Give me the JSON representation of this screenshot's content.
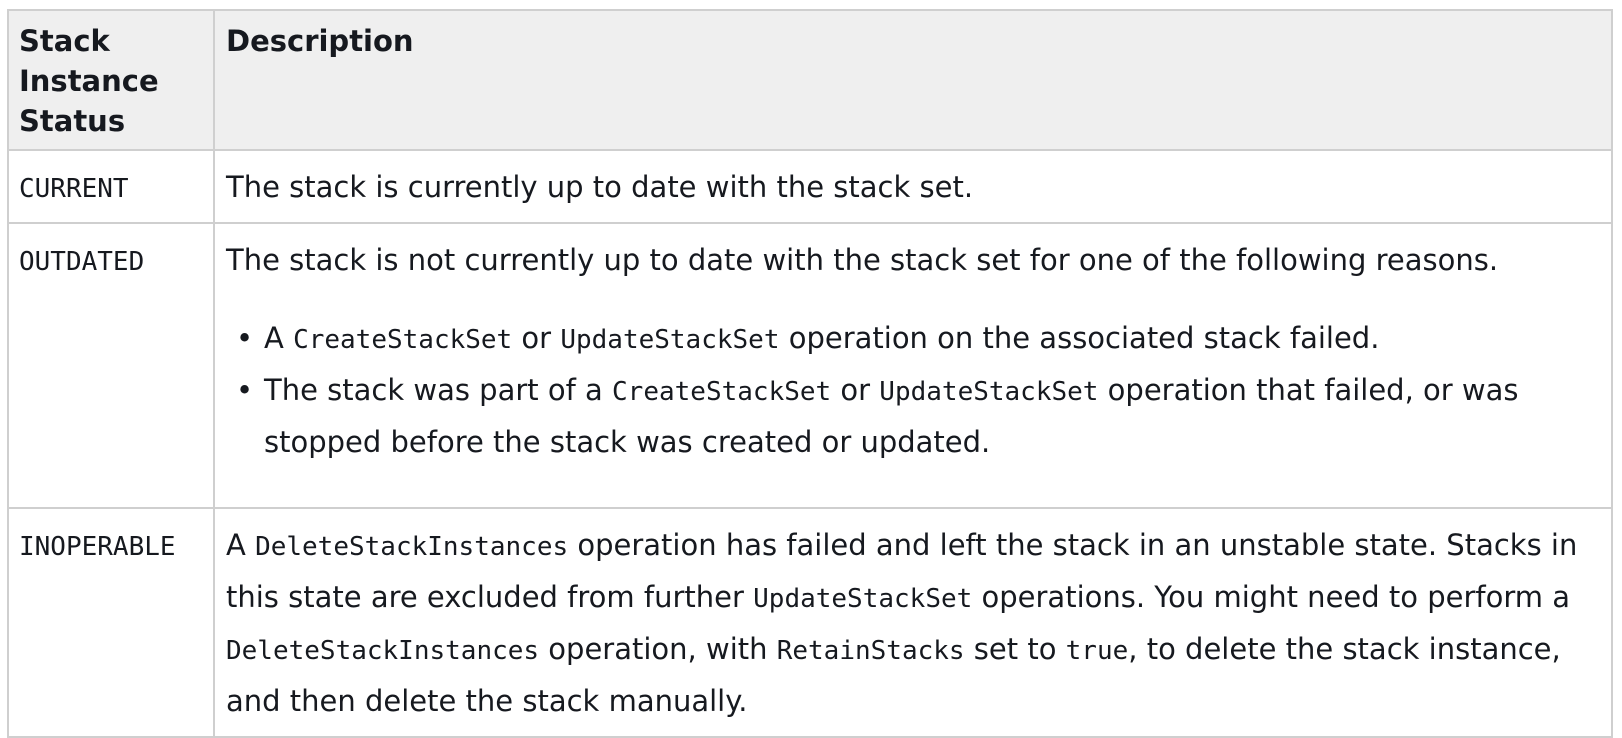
{
  "table": {
    "headers": {
      "status": "Stack Instance Status",
      "description": "Description"
    },
    "rows": {
      "current": {
        "status": "CURRENT",
        "description": "The stack is currently up to date with the stack set."
      },
      "outdated": {
        "status": "OUTDATED",
        "description": "The stack is not currently up to date with the stack set for one of the following reasons.",
        "reasons": [
          {
            "t1": "A ",
            "code1": "CreateStackSet",
            "t2": " or ",
            "code2": "UpdateStackSet",
            "t3": " operation on the associated stack failed."
          },
          {
            "t1": "The stack was part of a ",
            "code1": "CreateStackSet",
            "t2": " or ",
            "code2": "UpdateStackSet",
            "t3": " operation that failed, or was stopped before the stack was created or updated."
          }
        ]
      },
      "inoperable": {
        "status": "INOPERABLE",
        "t1": "A ",
        "code1": "DeleteStackInstances",
        "t2": " operation has failed and left the stack in an unstable state. Stacks in this state are excluded from further ",
        "code2": "UpdateStackSet",
        "t3": " operations. You might need to perform a ",
        "code3": "DeleteStackInstances",
        "t4": " operation, with ",
        "code4": "RetainStacks",
        "t5": " set to ",
        "code5": "true",
        "t6": ", to delete the stack instance, and then delete the stack manually."
      }
    }
  },
  "icons": {
    "bullet": "•"
  }
}
